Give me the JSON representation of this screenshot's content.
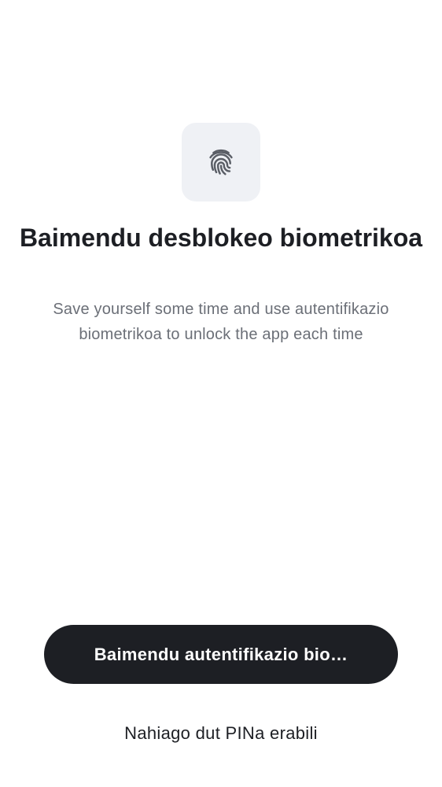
{
  "header": {
    "icon": "fingerprint-icon",
    "title": "Baimendu desblokeo biometrikoa",
    "subtitle": "Save yourself some time and use autentifikazio biometrikoa to unlock the app each time"
  },
  "actions": {
    "primary_label": "Baimendu autentifikazio bio…",
    "secondary_label": "Nahiago dut PINa erabili"
  },
  "colors": {
    "background": "#ffffff",
    "primary_button": "#1d1f24",
    "icon_tile": "#eff1f5",
    "subtitle_text": "#6b6f77"
  }
}
